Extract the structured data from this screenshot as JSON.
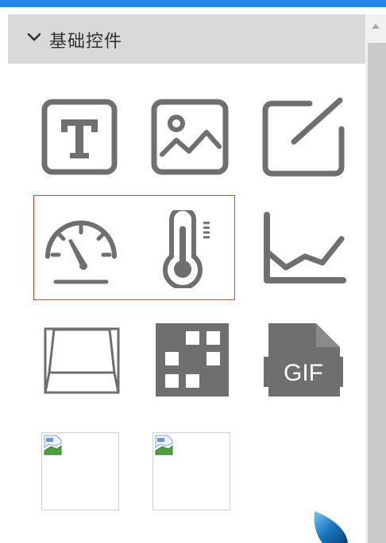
{
  "panel": {
    "title": "基础控件",
    "expanded": true
  },
  "tools": [
    {
      "icon": "text-icon"
    },
    {
      "icon": "image-icon"
    },
    {
      "icon": "edit-icon"
    },
    {
      "icon": "gauge-icon"
    },
    {
      "icon": "thermometer-icon"
    },
    {
      "icon": "line-chart-icon"
    },
    {
      "icon": "button-3d-icon"
    },
    {
      "icon": "grid-block-icon"
    },
    {
      "icon": "gif-icon",
      "label": "GIF"
    },
    {
      "icon": "broken-image-icon"
    },
    {
      "icon": "broken-image-icon"
    }
  ],
  "selected_group": [
    "gauge-icon",
    "thermometer-icon"
  ],
  "colors": {
    "accent_bar": "#1f86e5",
    "header_bg": "#d9d9d9",
    "icon_gray": "#6f6f6f",
    "selection": "#e53935",
    "scroll_thumb": "#c9c9c9"
  }
}
